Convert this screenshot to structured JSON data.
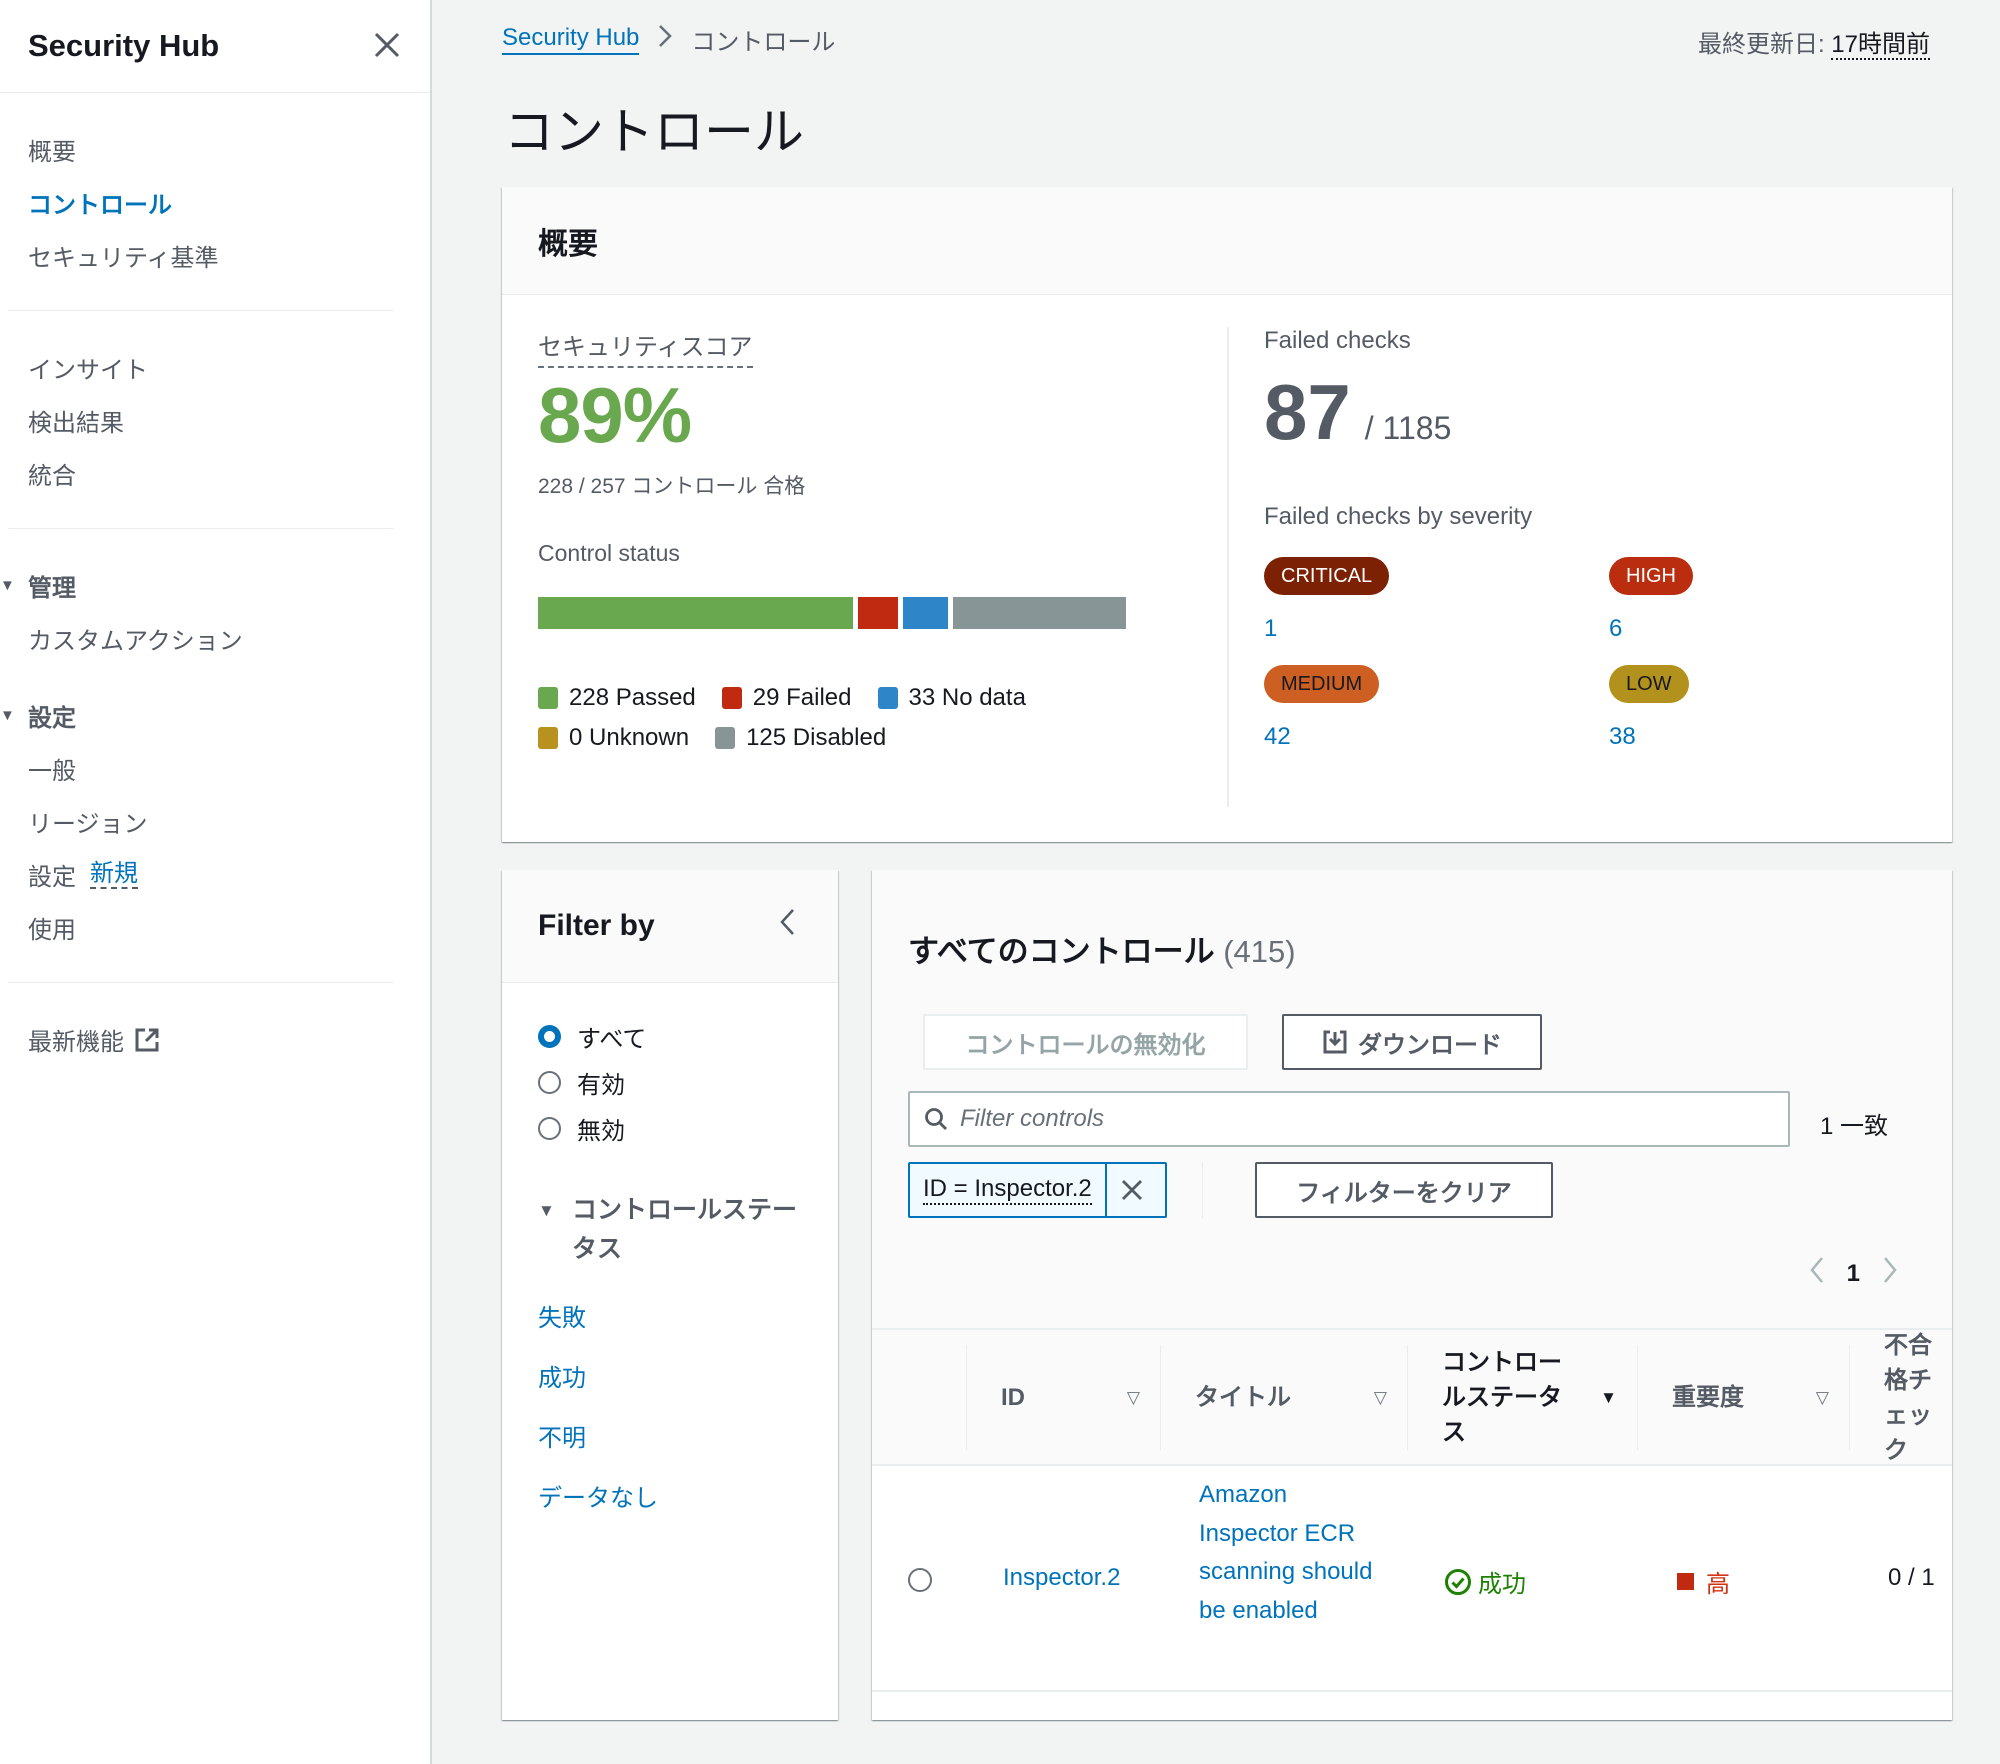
{
  "sidebar": {
    "title": "Security Hub",
    "close_icon": "close-icon",
    "groups": [
      {
        "items": [
          {
            "label": "概要",
            "active": false
          },
          {
            "label": "コントロール",
            "active": true
          },
          {
            "label": "セキュリティ基準",
            "active": false
          }
        ]
      },
      {
        "items": [
          {
            "label": "インサイト"
          },
          {
            "label": "検出結果"
          },
          {
            "label": "統合"
          }
        ]
      }
    ],
    "sections": [
      {
        "label": "管理",
        "expanded": true,
        "items": [
          {
            "label": "カスタムアクション"
          }
        ]
      },
      {
        "label": "設定",
        "expanded": true,
        "items": [
          {
            "label": "一般"
          },
          {
            "label": "リージョン"
          },
          {
            "label": "設定",
            "badge": "新規"
          },
          {
            "label": "使用"
          }
        ]
      }
    ],
    "footer_link": {
      "label": "最新機能",
      "icon": "external-link-icon"
    }
  },
  "header": {
    "breadcrumb": [
      {
        "label": "Security Hub",
        "link": true
      },
      {
        "label": "コントロール",
        "link": false
      }
    ],
    "last_updated_label": "最終更新日:",
    "last_updated_value": "17時間前",
    "page_title": "コントロール"
  },
  "overview": {
    "title": "概要",
    "security_score": {
      "label": "セキュリティスコア",
      "value": "89%",
      "subtext": "228 / 257 コントロール 合格"
    },
    "control_status": {
      "label": "Control status",
      "segments": [
        {
          "key": "passed",
          "count": 228,
          "label": "Passed",
          "color": "#6aa84f"
        },
        {
          "key": "failed",
          "count": 29,
          "label": "Failed",
          "color": "#bf2a10"
        },
        {
          "key": "nodata",
          "count": 33,
          "label": "No data",
          "color": "#2e86c8"
        },
        {
          "key": "unknown",
          "count": 0,
          "label": "Unknown",
          "color": "#b7921f"
        },
        {
          "key": "disabled",
          "count": 125,
          "label": "Disabled",
          "color": "#879596"
        }
      ],
      "legend_text": [
        "228 Passed",
        "29 Failed",
        "33 No data",
        "0 Unknown",
        "125 Disabled"
      ]
    },
    "failed_checks": {
      "label": "Failed checks",
      "value": "87",
      "total": "/ 1185",
      "by_severity_label": "Failed checks by severity",
      "severities": [
        {
          "label": "CRITICAL",
          "count": "1",
          "bg": "#7d2105",
          "fg": "#ffffff"
        },
        {
          "label": "HIGH",
          "count": "6",
          "bg": "#ba2e0f",
          "fg": "#ffffff"
        },
        {
          "label": "MEDIUM",
          "count": "42",
          "bg": "#cc5f21",
          "fg": "#16191f"
        },
        {
          "label": "LOW",
          "count": "38",
          "bg": "#b2911c",
          "fg": "#16191f"
        }
      ]
    }
  },
  "filter_panel": {
    "title": "Filter by",
    "collapse_icon": "chevron-left-icon",
    "radio_options": [
      {
        "label": "すべて",
        "checked": true
      },
      {
        "label": "有効",
        "checked": false
      },
      {
        "label": "無効",
        "checked": false
      }
    ],
    "status_section": {
      "title": "コントロールステータス",
      "links": [
        "失敗",
        "成功",
        "不明",
        "データなし"
      ]
    }
  },
  "controls": {
    "title": "すべてのコントロール",
    "count": "(415)",
    "disable_button": "コントロールの無効化",
    "download_button": "ダウンロード",
    "search_placeholder": "Filter controls",
    "search_value": "",
    "match_count": "1 一致",
    "filter_token": "ID = Inspector.2",
    "clear_filters_button": "フィルターをクリア",
    "pagination": {
      "current_page": "1"
    },
    "columns": [
      {
        "label": "ID",
        "sorted": false
      },
      {
        "label": "タイトル",
        "sorted": false
      },
      {
        "label": "コントロールステータス",
        "sorted": true
      },
      {
        "label": "重要度",
        "sorted": false
      },
      {
        "label": "不合格チェック",
        "sorted": false
      }
    ],
    "rows": [
      {
        "selected": false,
        "id": "Inspector.2",
        "title": "Amazon Inspector ECR scanning should be enabled",
        "status": "成功",
        "status_icon": "check-circle-icon",
        "severity": "高",
        "failed_checks": "0 / 1"
      }
    ]
  }
}
